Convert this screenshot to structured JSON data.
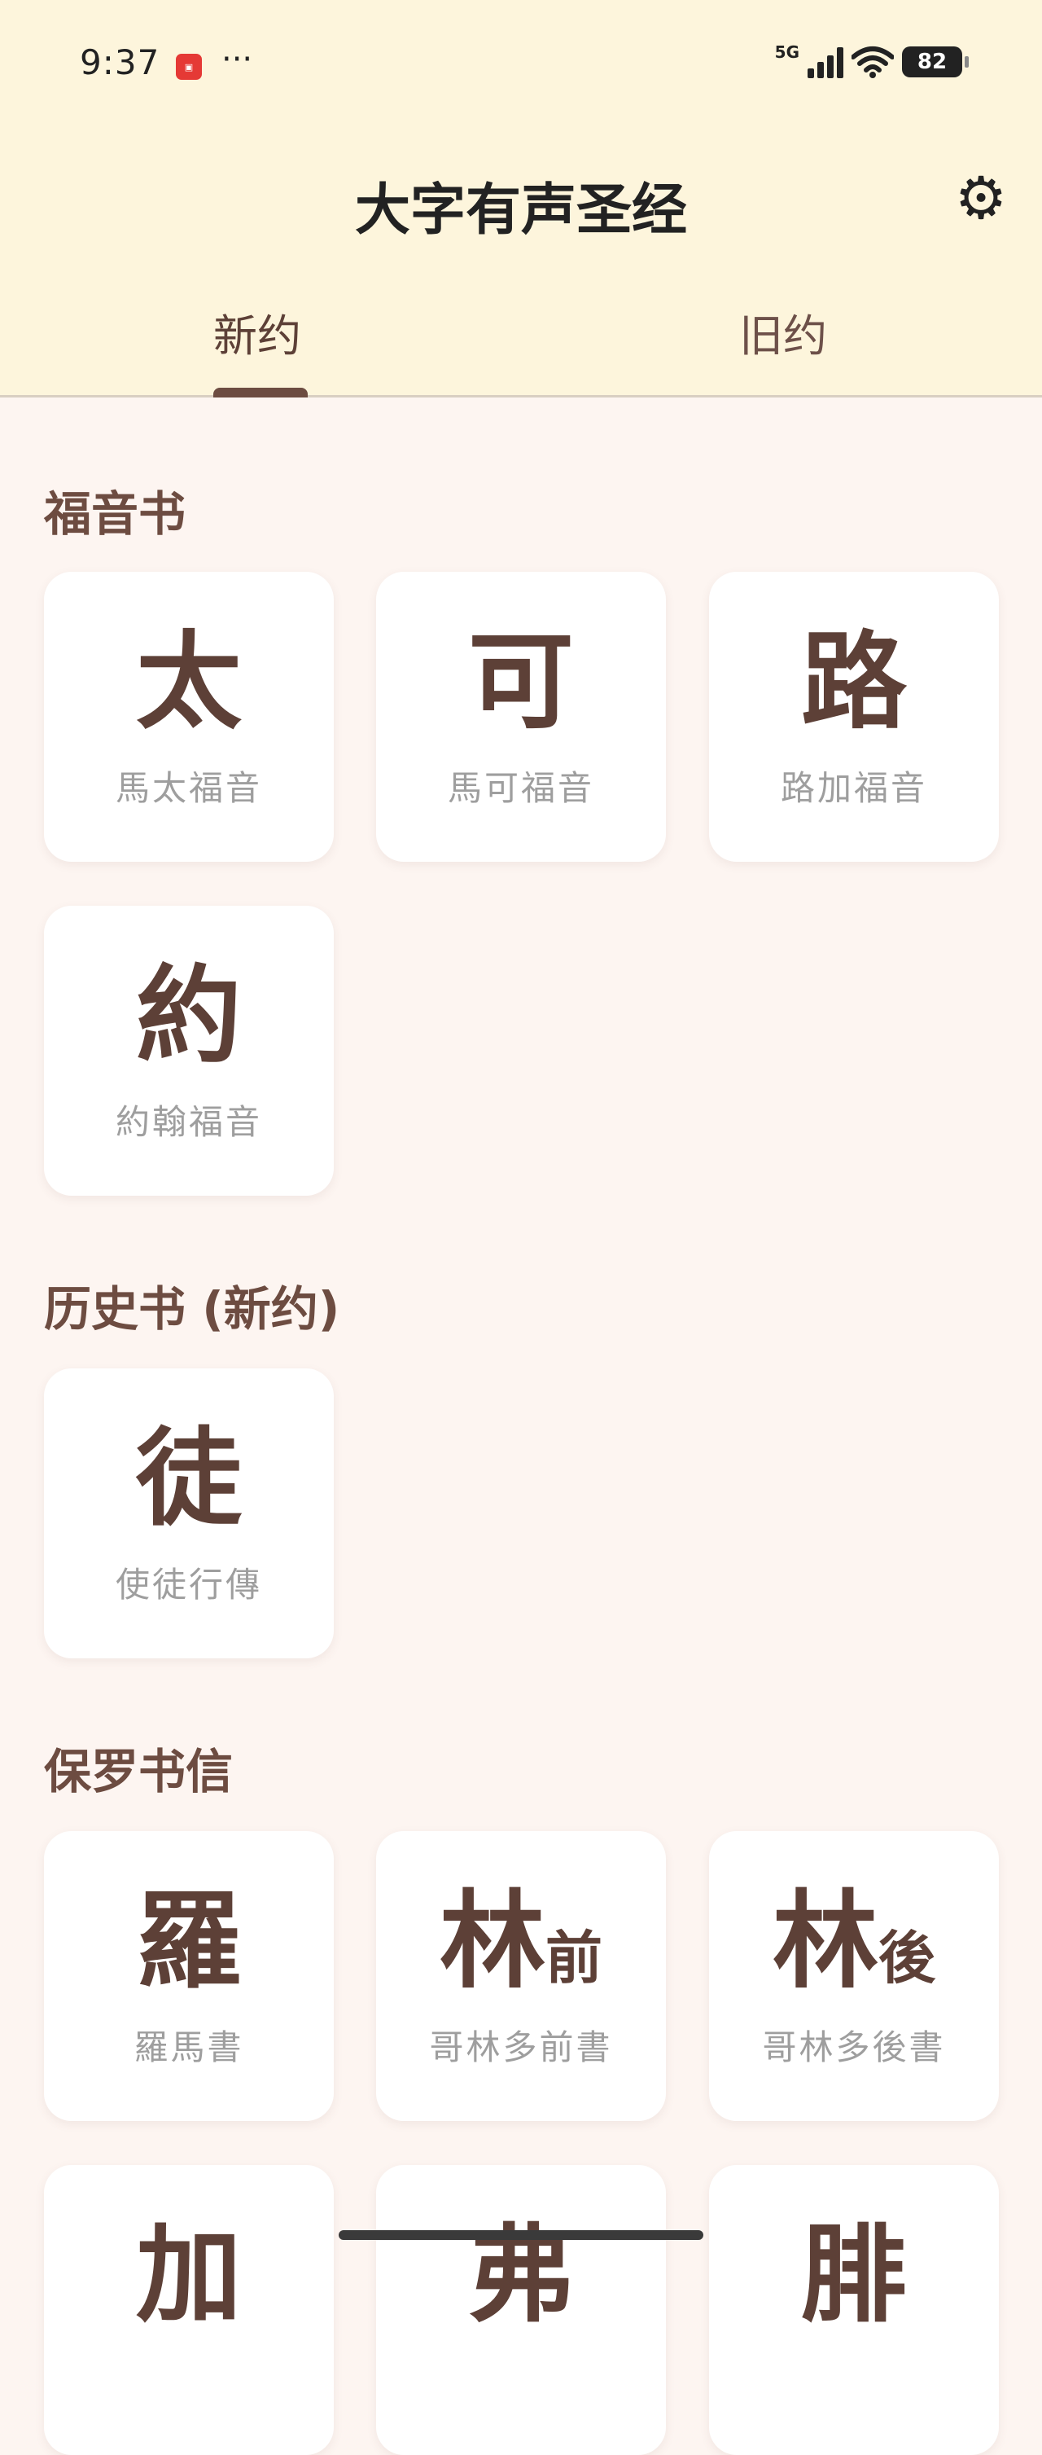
{
  "status": {
    "time": "9:37",
    "dots": "···",
    "network": "5G",
    "wifi_level": "6",
    "battery": "82"
  },
  "header": {
    "title": "大字有声圣经"
  },
  "tabs": [
    "新约",
    "旧约"
  ],
  "sections": [
    {
      "title": "福音书",
      "books": [
        {
          "big": "太",
          "small": "",
          "name": "馬太福音"
        },
        {
          "big": "可",
          "small": "",
          "name": "馬可福音"
        },
        {
          "big": "路",
          "small": "",
          "name": "路加福音"
        },
        {
          "big": "約",
          "small": "",
          "name": "約翰福音"
        }
      ]
    },
    {
      "title": "历史书 (新约)",
      "books": [
        {
          "big": "徒",
          "small": "",
          "name": "使徒行傳"
        }
      ]
    },
    {
      "title": "保罗书信",
      "books": [
        {
          "big": "羅",
          "small": "",
          "name": "羅馬書"
        },
        {
          "big": "林",
          "small": "前",
          "name": "哥林多前書"
        },
        {
          "big": "林",
          "small": "後",
          "name": "哥林多後書"
        },
        {
          "big": "加",
          "small": "",
          "name": ""
        },
        {
          "big": "弗",
          "small": "",
          "name": ""
        },
        {
          "big": "腓",
          "small": "",
          "name": ""
        }
      ]
    }
  ]
}
